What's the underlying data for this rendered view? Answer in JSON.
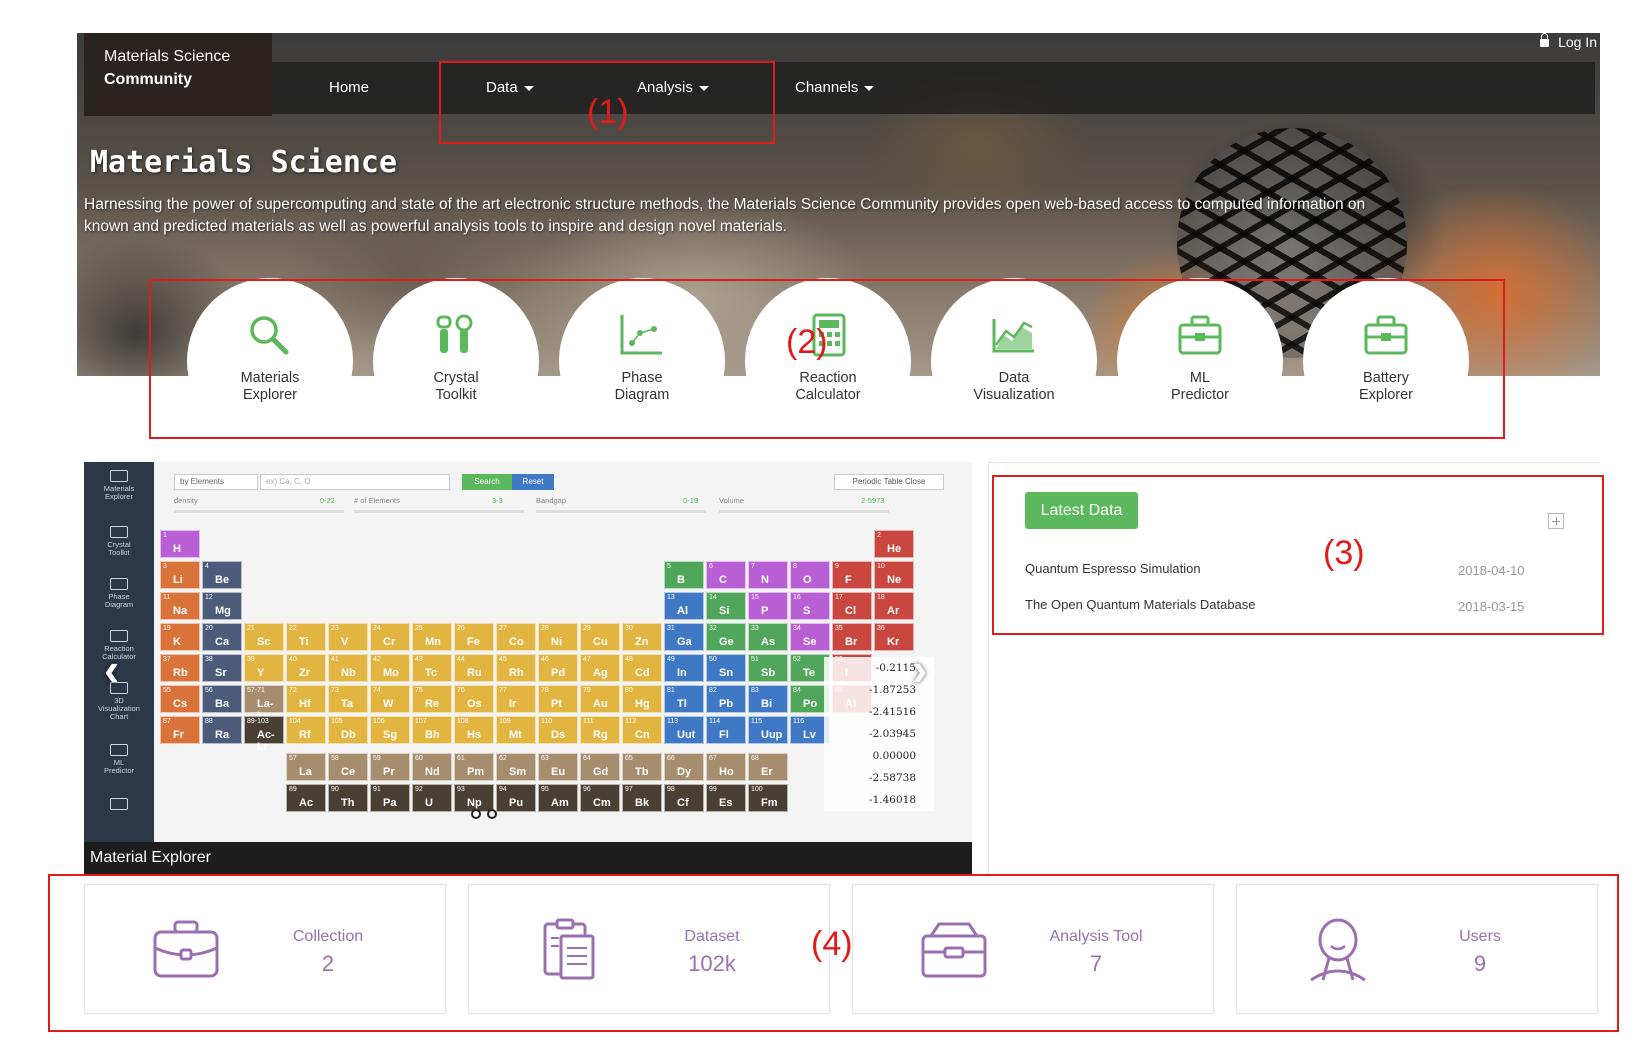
{
  "header": {
    "brand_line1": "Materials Science",
    "brand_line2": "Community",
    "login": "Log In",
    "nav": [
      {
        "label": "Home",
        "dropdown": false
      },
      {
        "label": "Data",
        "dropdown": true
      },
      {
        "label": "Analysis",
        "dropdown": true
      },
      {
        "label": "Channels",
        "dropdown": true
      }
    ]
  },
  "hero": {
    "title": "Materials Science",
    "description": "Harnessing the power of supercomputing and state of the art electronic structure methods, the Materials Science Community provides open web-based access to computed information on known and predicted materials as well as powerful analysis tools to inspire and design novel materials."
  },
  "tools": [
    {
      "label": "Materials\nExplorer",
      "icon": "magnifier-icon"
    },
    {
      "label": "Crystal\nToolkit",
      "icon": "toolkit-icon"
    },
    {
      "label": "Phase\nDiagram",
      "icon": "scatter-plot-icon"
    },
    {
      "label": "Reaction\nCalculator",
      "icon": "calculator-icon"
    },
    {
      "label": "Data\nVisualization",
      "icon": "area-chart-icon"
    },
    {
      "label": "ML\nPredictor",
      "icon": "toolbox-icon"
    },
    {
      "label": "Battery\nExplorer",
      "icon": "toolbox-icon"
    }
  ],
  "carousel": {
    "caption": "Material Explorer",
    "sidebar": [
      "Materials\nExplorer",
      "Crystal\nToolkit",
      "Phase\nDiagram",
      "Reaction\nCalculator",
      "3D\nVisualization\nChart",
      "ML\nPredictor",
      ""
    ],
    "search": {
      "select": "by Elements",
      "placeholder": "ex) Ca, C, O",
      "search_btn": "Search",
      "reset_btn": "Reset",
      "toggle": "Periodic Table Close"
    },
    "filters": [
      {
        "label": "density",
        "range": "0-22"
      },
      {
        "label": "# of Elements",
        "range": "3-3"
      },
      {
        "label": "Bandgap",
        "range": "0-19"
      },
      {
        "label": "Volume",
        "range": "2-5973"
      }
    ],
    "values": [
      "-0.2115",
      "-1.87253",
      "-2.41516",
      "-2.03945",
      "0.00000",
      "-2.58738",
      "-1.46018"
    ],
    "elements": [
      {
        "n": "1",
        "s": "H",
        "r": 0,
        "c": 0,
        "t": "nonmetal"
      },
      {
        "n": "2",
        "s": "He",
        "r": 0,
        "c": 17,
        "t": "noble"
      },
      {
        "n": "3",
        "s": "Li",
        "r": 1,
        "c": 0,
        "t": "alkali"
      },
      {
        "n": "4",
        "s": "Be",
        "r": 1,
        "c": 1,
        "t": "alkaline"
      },
      {
        "n": "5",
        "s": "B",
        "r": 1,
        "c": 12,
        "t": "metalloid"
      },
      {
        "n": "6",
        "s": "C",
        "r": 1,
        "c": 13,
        "t": "nonmetal"
      },
      {
        "n": "7",
        "s": "N",
        "r": 1,
        "c": 14,
        "t": "nonmetal"
      },
      {
        "n": "8",
        "s": "O",
        "r": 1,
        "c": 15,
        "t": "nonmetal"
      },
      {
        "n": "9",
        "s": "F",
        "r": 1,
        "c": 16,
        "t": "halogen"
      },
      {
        "n": "10",
        "s": "Ne",
        "r": 1,
        "c": 17,
        "t": "noble"
      },
      {
        "n": "11",
        "s": "Na",
        "r": 2,
        "c": 0,
        "t": "alkali"
      },
      {
        "n": "12",
        "s": "Mg",
        "r": 2,
        "c": 1,
        "t": "alkaline"
      },
      {
        "n": "13",
        "s": "Al",
        "r": 2,
        "c": 12,
        "t": "post"
      },
      {
        "n": "14",
        "s": "Si",
        "r": 2,
        "c": 13,
        "t": "metalloid"
      },
      {
        "n": "15",
        "s": "P",
        "r": 2,
        "c": 14,
        "t": "nonmetal"
      },
      {
        "n": "16",
        "s": "S",
        "r": 2,
        "c": 15,
        "t": "nonmetal"
      },
      {
        "n": "17",
        "s": "Cl",
        "r": 2,
        "c": 16,
        "t": "halogen"
      },
      {
        "n": "18",
        "s": "Ar",
        "r": 2,
        "c": 17,
        "t": "noble"
      },
      {
        "n": "19",
        "s": "K",
        "r": 3,
        "c": 0,
        "t": "alkali"
      },
      {
        "n": "20",
        "s": "Ca",
        "r": 3,
        "c": 1,
        "t": "alkaline"
      },
      {
        "n": "21",
        "s": "Sc",
        "r": 3,
        "c": 2,
        "t": "transition"
      },
      {
        "n": "22",
        "s": "Ti",
        "r": 3,
        "c": 3,
        "t": "transition"
      },
      {
        "n": "23",
        "s": "V",
        "r": 3,
        "c": 4,
        "t": "transition"
      },
      {
        "n": "24",
        "s": "Cr",
        "r": 3,
        "c": 5,
        "t": "transition"
      },
      {
        "n": "25",
        "s": "Mn",
        "r": 3,
        "c": 6,
        "t": "transition"
      },
      {
        "n": "26",
        "s": "Fe",
        "r": 3,
        "c": 7,
        "t": "transition"
      },
      {
        "n": "27",
        "s": "Co",
        "r": 3,
        "c": 8,
        "t": "transition"
      },
      {
        "n": "28",
        "s": "Ni",
        "r": 3,
        "c": 9,
        "t": "transition"
      },
      {
        "n": "29",
        "s": "Cu",
        "r": 3,
        "c": 10,
        "t": "transition"
      },
      {
        "n": "30",
        "s": "Zn",
        "r": 3,
        "c": 11,
        "t": "transition"
      },
      {
        "n": "31",
        "s": "Ga",
        "r": 3,
        "c": 12,
        "t": "post"
      },
      {
        "n": "32",
        "s": "Ge",
        "r": 3,
        "c": 13,
        "t": "metalloid"
      },
      {
        "n": "33",
        "s": "As",
        "r": 3,
        "c": 14,
        "t": "metalloid"
      },
      {
        "n": "34",
        "s": "Se",
        "r": 3,
        "c": 15,
        "t": "nonmetal"
      },
      {
        "n": "35",
        "s": "Br",
        "r": 3,
        "c": 16,
        "t": "halogen"
      },
      {
        "n": "36",
        "s": "Kr",
        "r": 3,
        "c": 17,
        "t": "noble"
      },
      {
        "n": "37",
        "s": "Rb",
        "r": 4,
        "c": 0,
        "t": "alkali"
      },
      {
        "n": "38",
        "s": "Sr",
        "r": 4,
        "c": 1,
        "t": "alkaline"
      },
      {
        "n": "39",
        "s": "Y",
        "r": 4,
        "c": 2,
        "t": "transition"
      },
      {
        "n": "40",
        "s": "Zr",
        "r": 4,
        "c": 3,
        "t": "transition"
      },
      {
        "n": "41",
        "s": "Nb",
        "r": 4,
        "c": 4,
        "t": "transition"
      },
      {
        "n": "42",
        "s": "Mo",
        "r": 4,
        "c": 5,
        "t": "transition"
      },
      {
        "n": "43",
        "s": "Tc",
        "r": 4,
        "c": 6,
        "t": "transition"
      },
      {
        "n": "44",
        "s": "Ru",
        "r": 4,
        "c": 7,
        "t": "transition"
      },
      {
        "n": "45",
        "s": "Rh",
        "r": 4,
        "c": 8,
        "t": "transition"
      },
      {
        "n": "46",
        "s": "Pd",
        "r": 4,
        "c": 9,
        "t": "transition"
      },
      {
        "n": "47",
        "s": "Ag",
        "r": 4,
        "c": 10,
        "t": "transition"
      },
      {
        "n": "48",
        "s": "Cd",
        "r": 4,
        "c": 11,
        "t": "transition"
      },
      {
        "n": "49",
        "s": "In",
        "r": 4,
        "c": 12,
        "t": "post"
      },
      {
        "n": "50",
        "s": "Sn",
        "r": 4,
        "c": 13,
        "t": "post"
      },
      {
        "n": "51",
        "s": "Sb",
        "r": 4,
        "c": 14,
        "t": "metalloid"
      },
      {
        "n": "52",
        "s": "Te",
        "r": 4,
        "c": 15,
        "t": "metalloid"
      },
      {
        "n": "53",
        "s": "I",
        "r": 4,
        "c": 16,
        "t": "halogen"
      },
      {
        "n": "55",
        "s": "Cs",
        "r": 5,
        "c": 0,
        "t": "alkali"
      },
      {
        "n": "56",
        "s": "Ba",
        "r": 5,
        "c": 1,
        "t": "alkaline"
      },
      {
        "n": "57-71",
        "s": "La-Lu",
        "r": 5,
        "c": 2,
        "t": "lanthanide"
      },
      {
        "n": "72",
        "s": "Hf",
        "r": 5,
        "c": 3,
        "t": "transition"
      },
      {
        "n": "73",
        "s": "Ta",
        "r": 5,
        "c": 4,
        "t": "transition"
      },
      {
        "n": "74",
        "s": "W",
        "r": 5,
        "c": 5,
        "t": "transition"
      },
      {
        "n": "75",
        "s": "Re",
        "r": 5,
        "c": 6,
        "t": "transition"
      },
      {
        "n": "76",
        "s": "Os",
        "r": 5,
        "c": 7,
        "t": "transition"
      },
      {
        "n": "77",
        "s": "Ir",
        "r": 5,
        "c": 8,
        "t": "transition"
      },
      {
        "n": "78",
        "s": "Pt",
        "r": 5,
        "c": 9,
        "t": "transition"
      },
      {
        "n": "79",
        "s": "Au",
        "r": 5,
        "c": 10,
        "t": "transition"
      },
      {
        "n": "80",
        "s": "Hg",
        "r": 5,
        "c": 11,
        "t": "transition"
      },
      {
        "n": "81",
        "s": "Tl",
        "r": 5,
        "c": 12,
        "t": "post"
      },
      {
        "n": "82",
        "s": "Pb",
        "r": 5,
        "c": 13,
        "t": "post"
      },
      {
        "n": "83",
        "s": "Bi",
        "r": 5,
        "c": 14,
        "t": "post"
      },
      {
        "n": "84",
        "s": "Po",
        "r": 5,
        "c": 15,
        "t": "metalloid"
      },
      {
        "n": "85",
        "s": "At",
        "r": 5,
        "c": 16,
        "t": "halogen"
      },
      {
        "n": "87",
        "s": "Fr",
        "r": 6,
        "c": 0,
        "t": "alkali"
      },
      {
        "n": "88",
        "s": "Ra",
        "r": 6,
        "c": 1,
        "t": "alkaline"
      },
      {
        "n": "89-103",
        "s": "Ac-Lr",
        "r": 6,
        "c": 2,
        "t": "actinide"
      },
      {
        "n": "104",
        "s": "Rf",
        "r": 6,
        "c": 3,
        "t": "transition"
      },
      {
        "n": "105",
        "s": "Db",
        "r": 6,
        "c": 4,
        "t": "transition"
      },
      {
        "n": "106",
        "s": "Sg",
        "r": 6,
        "c": 5,
        "t": "transition"
      },
      {
        "n": "107",
        "s": "Bh",
        "r": 6,
        "c": 6,
        "t": "transition"
      },
      {
        "n": "108",
        "s": "Hs",
        "r": 6,
        "c": 7,
        "t": "transition"
      },
      {
        "n": "109",
        "s": "Mt",
        "r": 6,
        "c": 8,
        "t": "transition"
      },
      {
        "n": "110",
        "s": "Ds",
        "r": 6,
        "c": 9,
        "t": "transition"
      },
      {
        "n": "111",
        "s": "Rg",
        "r": 6,
        "c": 10,
        "t": "transition"
      },
      {
        "n": "112",
        "s": "Cn",
        "r": 6,
        "c": 11,
        "t": "transition"
      },
      {
        "n": "113",
        "s": "Uut",
        "r": 6,
        "c": 12,
        "t": "post"
      },
      {
        "n": "114",
        "s": "Fl",
        "r": 6,
        "c": 13,
        "t": "post"
      },
      {
        "n": "115",
        "s": "Uup",
        "r": 6,
        "c": 14,
        "t": "post"
      },
      {
        "n": "116",
        "s": "Lv",
        "r": 6,
        "c": 15,
        "t": "post"
      },
      {
        "n": "57",
        "s": "La",
        "r": 7,
        "c": 3,
        "t": "lanthanide"
      },
      {
        "n": "58",
        "s": "Ce",
        "r": 7,
        "c": 4,
        "t": "lanthanide"
      },
      {
        "n": "59",
        "s": "Pr",
        "r": 7,
        "c": 5,
        "t": "lanthanide"
      },
      {
        "n": "60",
        "s": "Nd",
        "r": 7,
        "c": 6,
        "t": "lanthanide"
      },
      {
        "n": "61",
        "s": "Pm",
        "r": 7,
        "c": 7,
        "t": "lanthanide"
      },
      {
        "n": "62",
        "s": "Sm",
        "r": 7,
        "c": 8,
        "t": "lanthanide"
      },
      {
        "n": "63",
        "s": "Eu",
        "r": 7,
        "c": 9,
        "t": "lanthanide"
      },
      {
        "n": "64",
        "s": "Gd",
        "r": 7,
        "c": 10,
        "t": "lanthanide"
      },
      {
        "n": "65",
        "s": "Tb",
        "r": 7,
        "c": 11,
        "t": "lanthanide"
      },
      {
        "n": "66",
        "s": "Dy",
        "r": 7,
        "c": 12,
        "t": "lanthanide"
      },
      {
        "n": "67",
        "s": "Ho",
        "r": 7,
        "c": 13,
        "t": "lanthanide"
      },
      {
        "n": "68",
        "s": "Er",
        "r": 7,
        "c": 14,
        "t": "lanthanide"
      },
      {
        "n": "89",
        "s": "Ac",
        "r": 8,
        "c": 3,
        "t": "actinide"
      },
      {
        "n": "90",
        "s": "Th",
        "r": 8,
        "c": 4,
        "t": "actinide"
      },
      {
        "n": "91",
        "s": "Pa",
        "r": 8,
        "c": 5,
        "t": "actinide"
      },
      {
        "n": "92",
        "s": "U",
        "r": 8,
        "c": 6,
        "t": "actinide"
      },
      {
        "n": "93",
        "s": "Np",
        "r": 8,
        "c": 7,
        "t": "actinide"
      },
      {
        "n": "94",
        "s": "Pu",
        "r": 8,
        "c": 8,
        "t": "actinide"
      },
      {
        "n": "95",
        "s": "Am",
        "r": 8,
        "c": 9,
        "t": "actinide"
      },
      {
        "n": "96",
        "s": "Cm",
        "r": 8,
        "c": 10,
        "t": "actinide"
      },
      {
        "n": "97",
        "s": "Bk",
        "r": 8,
        "c": 11,
        "t": "actinide"
      },
      {
        "n": "98",
        "s": "Cf",
        "r": 8,
        "c": 12,
        "t": "actinide"
      },
      {
        "n": "99",
        "s": "Es",
        "r": 8,
        "c": 13,
        "t": "actinide"
      },
      {
        "n": "100",
        "s": "Fm",
        "r": 8,
        "c": 14,
        "t": "actinide"
      }
    ],
    "element_colors": {
      "nonmetal": "#b85fd6",
      "noble": "#c9473f",
      "alkali": "#d9733a",
      "alkaline": "#4c5b7a",
      "metalloid": "#50a65a",
      "halogen": "#c9473f",
      "post": "#3f79c6",
      "transition": "#e2b440",
      "lanthanide": "#a58d6e",
      "actinide": "#4a3f33"
    }
  },
  "latest": {
    "button": "Latest Data",
    "items": [
      {
        "title": "Quantum Espresso Simulation",
        "date": "2018-04-10"
      },
      {
        "title": "The Open Quantum Materials Database",
        "date": "2018-03-15"
      }
    ]
  },
  "stats": [
    {
      "label": "Collection",
      "value": "2",
      "icon": "briefcase-icon"
    },
    {
      "label": "Dataset",
      "value": "102k",
      "icon": "clipboard-icon"
    },
    {
      "label": "Analysis Tool",
      "value": "7",
      "icon": "toolbox-icon"
    },
    {
      "label": "Users",
      "value": "9",
      "icon": "user-icon"
    }
  ],
  "annotations": [
    "(1)",
    "(2)",
    "(3)",
    "(4)"
  ],
  "colors": {
    "accent_green": "#5cb85c",
    "stat_purple": "#9b6fb0",
    "annotation_red": "#e01b1b"
  }
}
